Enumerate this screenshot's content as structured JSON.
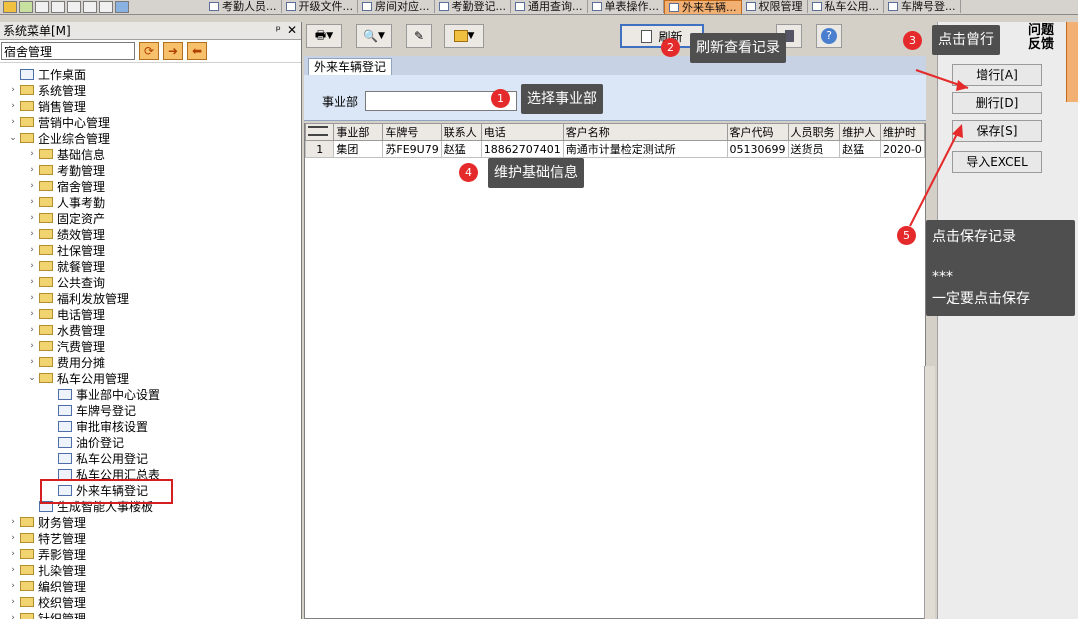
{
  "taskbar": {
    "tabs": [
      "考勤人员...",
      "开级文件...",
      "房间对应...",
      "考勤登记...",
      "通用查询...",
      "单表操作...",
      "外来车辆...",
      "权限管理",
      "私车公用...",
      "车牌号登..."
    ]
  },
  "left_panel": {
    "title": "系统菜单[M]",
    "pin": "ᵖ",
    "close": "✕",
    "search_value": "宿舍管理",
    "tree": [
      {
        "label": "工作桌面",
        "level": 0,
        "type": "doc",
        "exp": ""
      },
      {
        "label": "系统管理",
        "level": 0,
        "type": "folder",
        "exp": "›"
      },
      {
        "label": "销售管理",
        "level": 0,
        "type": "folder",
        "exp": "›"
      },
      {
        "label": "营销中心管理",
        "level": 0,
        "type": "folder",
        "exp": "›"
      },
      {
        "label": "企业综合管理",
        "level": 0,
        "type": "folder",
        "exp": "⌄"
      },
      {
        "label": "基础信息",
        "level": 1,
        "type": "folder",
        "exp": "›"
      },
      {
        "label": "考勤管理",
        "level": 1,
        "type": "folder",
        "exp": "›"
      },
      {
        "label": "宿舍管理",
        "level": 1,
        "type": "folder",
        "exp": "›"
      },
      {
        "label": "人事考勤",
        "level": 1,
        "type": "folder",
        "exp": "›"
      },
      {
        "label": "固定资产",
        "level": 1,
        "type": "folder",
        "exp": "›"
      },
      {
        "label": "绩效管理",
        "level": 1,
        "type": "folder",
        "exp": "›"
      },
      {
        "label": "社保管理",
        "level": 1,
        "type": "folder",
        "exp": "›"
      },
      {
        "label": "就餐管理",
        "level": 1,
        "type": "folder",
        "exp": "›"
      },
      {
        "label": "公共查询",
        "level": 1,
        "type": "folder",
        "exp": "›"
      },
      {
        "label": "福利发放管理",
        "level": 1,
        "type": "folder",
        "exp": "›"
      },
      {
        "label": "电话管理",
        "level": 1,
        "type": "folder",
        "exp": "›"
      },
      {
        "label": "水费管理",
        "level": 1,
        "type": "folder",
        "exp": "›"
      },
      {
        "label": "汽费管理",
        "level": 1,
        "type": "folder",
        "exp": "›"
      },
      {
        "label": "费用分摊",
        "level": 1,
        "type": "folder",
        "exp": "›"
      },
      {
        "label": "私车公用管理",
        "level": 1,
        "type": "folder",
        "exp": "⌄"
      },
      {
        "label": "事业部中心设置",
        "level": 2,
        "type": "doc",
        "exp": ""
      },
      {
        "label": "车牌号登记",
        "level": 2,
        "type": "doc",
        "exp": ""
      },
      {
        "label": "审批审核设置",
        "level": 2,
        "type": "doc",
        "exp": ""
      },
      {
        "label": "油价登记",
        "level": 2,
        "type": "doc",
        "exp": ""
      },
      {
        "label": "私车公用登记",
        "level": 2,
        "type": "doc",
        "exp": ""
      },
      {
        "label": "私车公用汇总表",
        "level": 2,
        "type": "doc",
        "exp": ""
      },
      {
        "label": "外来车辆登记",
        "level": 2,
        "type": "doc",
        "exp": ""
      },
      {
        "label": "生成智能人事楼板",
        "level": 1,
        "type": "doc",
        "exp": ""
      },
      {
        "label": "财务管理",
        "level": 0,
        "type": "folder",
        "exp": "›"
      },
      {
        "label": "特艺管理",
        "level": 0,
        "type": "folder",
        "exp": "›"
      },
      {
        "label": "弄影管理",
        "level": 0,
        "type": "folder",
        "exp": "›"
      },
      {
        "label": "扎染管理",
        "level": 0,
        "type": "folder",
        "exp": "›"
      },
      {
        "label": "编织管理",
        "level": 0,
        "type": "folder",
        "exp": "›"
      },
      {
        "label": "校织管理",
        "level": 0,
        "type": "folder",
        "exp": "›"
      },
      {
        "label": "针织管理",
        "level": 0,
        "type": "folder",
        "exp": "›"
      }
    ]
  },
  "toolbar": {
    "refresh_label": "刷新",
    "help_icon": "?"
  },
  "form": {
    "tab_title": "外来车辆登记",
    "dept_label": "事业部",
    "dept_value": ""
  },
  "grid": {
    "columns": [
      "",
      "事业部",
      "车牌号",
      "联系人",
      "电话",
      "客户名称",
      "客户代码",
      "人员职务",
      "维护人",
      "维护时"
    ],
    "rows": [
      [
        "1",
        "集团",
        "苏FE9U79",
        "赵猛",
        "18862707401",
        "南通市计量检定测试所",
        "05130699",
        "送货员",
        "赵猛",
        "2020-0"
      ]
    ]
  },
  "side_buttons": {
    "add_row": "增行[A]",
    "delete_row": "删行[D]",
    "save": "保存[S]",
    "import_excel": "导入EXCEL"
  },
  "feedback_label": "问题反馈",
  "annotations": [
    {
      "num": "1",
      "text": "选择事业部"
    },
    {
      "num": "2",
      "text": "刷新查看记录"
    },
    {
      "num": "3",
      "text": "点击曾行"
    },
    {
      "num": "4",
      "text": "维护基础信息"
    },
    {
      "num": "5",
      "text": "点击保存记录",
      "line2": "***",
      "line3": "一定要点击保存"
    }
  ],
  "colors": {
    "accent_orange": "#f3b073",
    "annotation_red": "#e42a2a",
    "callout_bg": "#4f4f4f",
    "highlight_red": "#d51f1f"
  }
}
